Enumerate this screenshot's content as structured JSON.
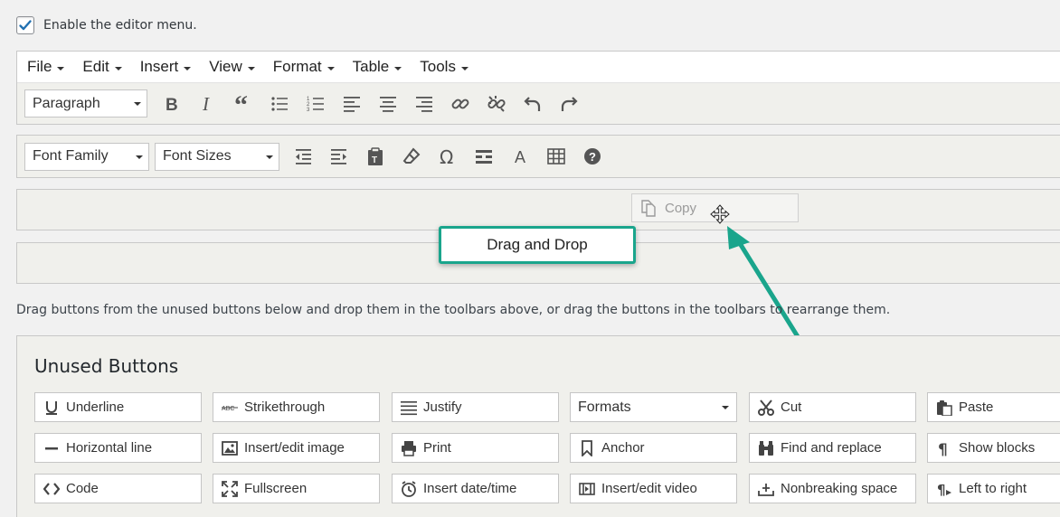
{
  "enable": {
    "label": "Enable the editor menu.",
    "checked": true
  },
  "menubar": [
    "File",
    "Edit",
    "Insert",
    "View",
    "Format",
    "Table",
    "Tools"
  ],
  "toolbar1": {
    "format_select": "Paragraph",
    "icons": [
      "bold-icon",
      "italic-icon",
      "blockquote-icon",
      "bullet-list-icon",
      "numbered-list-icon",
      "align-left-icon",
      "align-center-icon",
      "align-right-icon",
      "link-icon",
      "unlink-icon",
      "undo-icon",
      "redo-icon"
    ]
  },
  "toolbar2": {
    "font_family": "Font Family",
    "font_sizes": "Font Sizes",
    "icons": [
      "outdent-icon",
      "indent-icon",
      "paste-text-icon",
      "clear-format-icon",
      "omega-icon",
      "hr-icon",
      "text-color-icon",
      "table-icon",
      "help-icon"
    ]
  },
  "drag_ghost": {
    "label": "Copy"
  },
  "callout": {
    "label": "Drag and Drop"
  },
  "help_text": "Drag buttons from the unused buttons below and drop them in the toolbars above, or drag the buttons in the toolbars to rearrange them.",
  "unused": {
    "title": "Unused Buttons",
    "rows": [
      [
        {
          "label": "Underline",
          "icon": "underline-icon"
        },
        {
          "label": "Strikethrough",
          "icon": "strikethrough-icon"
        },
        {
          "label": "Justify",
          "icon": "justify-icon"
        },
        {
          "label": "Formats",
          "icon": "",
          "select": true
        },
        {
          "label": "Cut",
          "icon": "cut-icon"
        },
        {
          "label": "Paste",
          "icon": "paste-icon"
        }
      ],
      [
        {
          "label": "Horizontal line",
          "icon": "horizontal-line-icon"
        },
        {
          "label": "Insert/edit image",
          "icon": "image-icon"
        },
        {
          "label": "Print",
          "icon": "print-icon"
        },
        {
          "label": "Anchor",
          "icon": "anchor-icon"
        },
        {
          "label": "Find and replace",
          "icon": "binoculars-icon"
        },
        {
          "label": "Show blocks",
          "icon": "pilcrow-icon"
        }
      ],
      [
        {
          "label": "Code",
          "icon": "code-icon"
        },
        {
          "label": "Fullscreen",
          "icon": "fullscreen-icon"
        },
        {
          "label": "Insert date/time",
          "icon": "clock-icon"
        },
        {
          "label": "Insert/edit video",
          "icon": "video-icon"
        },
        {
          "label": "Nonbreaking space",
          "icon": "nbsp-icon"
        },
        {
          "label": "Left to right",
          "icon": "ltr-icon"
        }
      ]
    ]
  },
  "colors": {
    "accent": "#1aa58c",
    "checkbox": "#2271b1"
  }
}
